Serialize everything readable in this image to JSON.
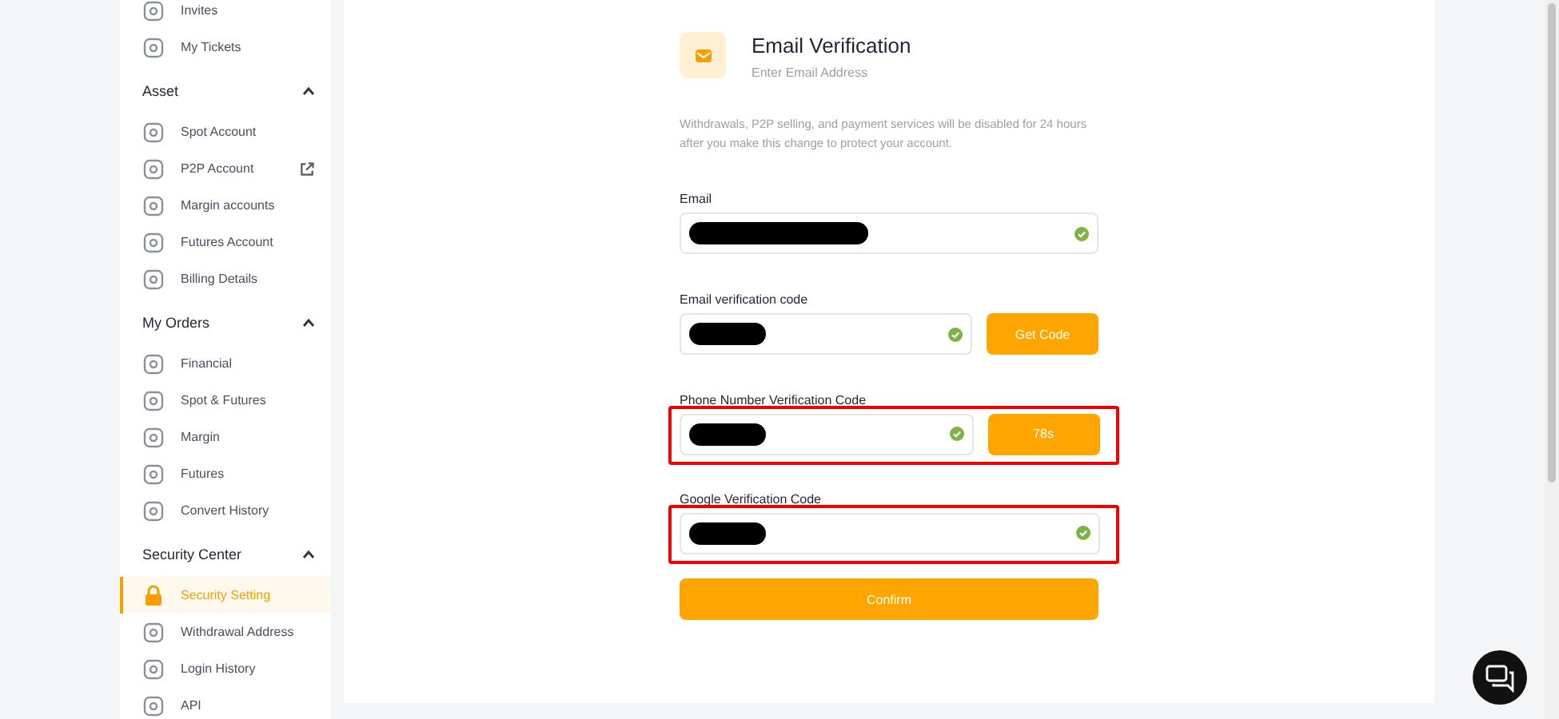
{
  "sidebar": {
    "sections": [
      {
        "items": [
          {
            "label": "Invites",
            "selected": false
          },
          {
            "label": "My Tickets",
            "selected": false
          }
        ]
      },
      {
        "title": "Asset",
        "expanded": true,
        "items": [
          {
            "label": "Spot Account",
            "selected": false
          },
          {
            "label": "P2P Account",
            "selected": false,
            "external": true
          },
          {
            "label": "Margin accounts",
            "selected": false
          },
          {
            "label": "Futures Account",
            "selected": false
          },
          {
            "label": "Billing Details",
            "selected": false
          }
        ]
      },
      {
        "title": "My Orders",
        "expanded": true,
        "items": [
          {
            "label": "Financial",
            "selected": false
          },
          {
            "label": "Spot & Futures",
            "selected": false
          },
          {
            "label": "Margin",
            "selected": false
          },
          {
            "label": "Futures",
            "selected": false
          },
          {
            "label": "Convert History",
            "selected": false
          }
        ]
      },
      {
        "title": "Security Center",
        "expanded": true,
        "items": [
          {
            "label": "Security Setting",
            "selected": true
          },
          {
            "label": "Withdrawal Address",
            "selected": false
          },
          {
            "label": "Login History",
            "selected": false
          },
          {
            "label": "API",
            "selected": false
          }
        ]
      }
    ]
  },
  "form": {
    "title": "Email Verification",
    "subtitle": "Enter Email Address",
    "notice": "Withdrawals, P2P selling, and payment services will be disabled for 24 hours after you make this change to protect your account.",
    "fields": [
      {
        "label": "Email",
        "redacted": true,
        "verified": true,
        "highlighted": false
      },
      {
        "label": "Email verification code",
        "redacted": true,
        "verified": true,
        "highlighted": false,
        "button": "Get Code"
      },
      {
        "label": "Phone Number Verification Code",
        "redacted": true,
        "verified": true,
        "highlighted": true,
        "button": "78s"
      },
      {
        "label": "Google Verification Code",
        "redacted": true,
        "verified": true,
        "highlighted": true
      }
    ],
    "submit": "Confirm"
  }
}
